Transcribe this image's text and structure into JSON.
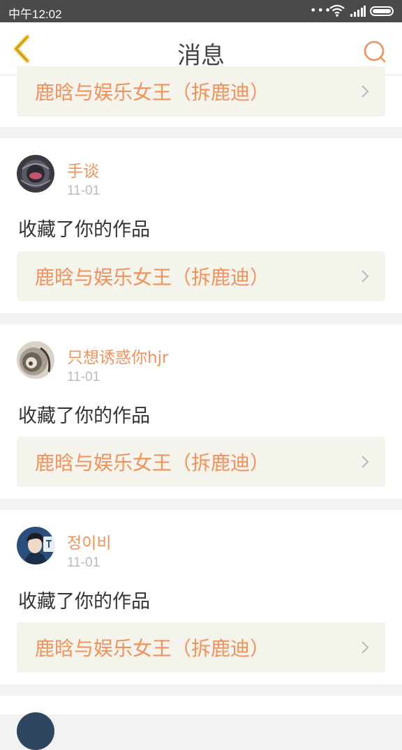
{
  "status_bar": {
    "time": "中午12:02",
    "dots": "•••"
  },
  "header": {
    "title": "消息"
  },
  "messages": [
    {
      "work_title": "鹿晗与娱乐女王（拆鹿迪）"
    },
    {
      "username": "手谈",
      "date": "11-01",
      "action": "收藏了你的作品",
      "work_title": "鹿晗与娱乐女王（拆鹿迪）"
    },
    {
      "username": "只想诱惑你hjr",
      "date": "11-01",
      "action": "收藏了你的作品",
      "work_title": "鹿晗与娱乐女王（拆鹿迪）"
    },
    {
      "username": "정이비",
      "date": "11-01",
      "action": "收藏了你的作品",
      "work_title": "鹿晗与娱乐女王（拆鹿迪）"
    }
  ],
  "icons": [
    "back-arrow-icon",
    "search-icon",
    "chevron-right-icon",
    "wifi-icon",
    "signal-icon",
    "battery-icon"
  ],
  "colors": {
    "accent": "#f0925c",
    "back_icon": "#f2c230",
    "link_bg": "#f4f3ec",
    "status_bar": "#4a4a4a"
  }
}
